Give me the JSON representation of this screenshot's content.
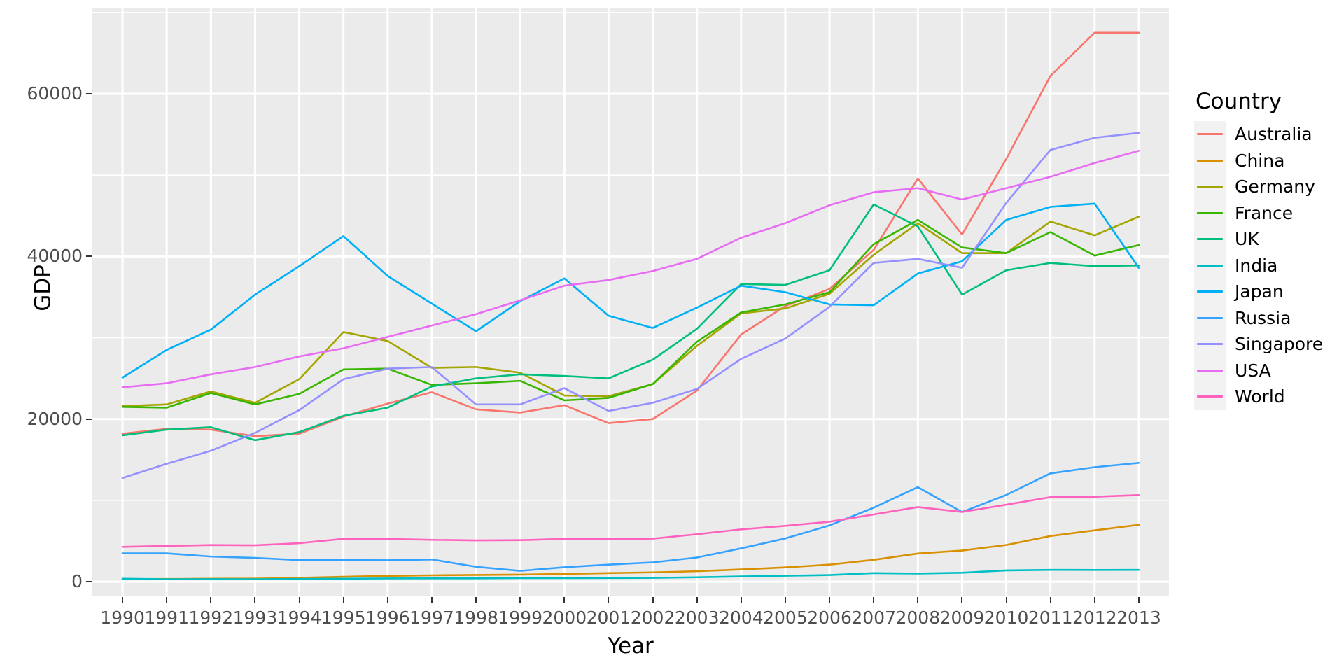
{
  "chart_data": {
    "type": "line",
    "title": "",
    "xlabel": "Year",
    "ylabel": "GDP",
    "legend_title": "Country",
    "legend_position": "right",
    "grid": true,
    "x": [
      1990,
      1991,
      1992,
      1993,
      1994,
      1995,
      1996,
      1997,
      1998,
      1999,
      2000,
      2001,
      2002,
      2003,
      2004,
      2005,
      2006,
      2007,
      2008,
      2009,
      2010,
      2011,
      2012,
      2013
    ],
    "xtick_labels": [
      "1990",
      "1991",
      "1992",
      "1993",
      "1994",
      "1995",
      "1996",
      "1997",
      "1998",
      "1999",
      "2000",
      "2001",
      "2002",
      "2003",
      "2004",
      "2005",
      "2006",
      "2007",
      "2008",
      "2009",
      "2010",
      "2011",
      "2012",
      "2013"
    ],
    "ytick_labels": [
      "0",
      "20000",
      "40000",
      "60000"
    ],
    "ytick_values": [
      0,
      20000,
      40000,
      60000
    ],
    "ylim": [
      -1800,
      70500
    ],
    "series": [
      {
        "name": "Australia",
        "color": "#f8766d",
        "values": [
          18200,
          18800,
          18700,
          17900,
          18200,
          20300,
          21900,
          23300,
          21200,
          20800,
          21700,
          19500,
          20000,
          23500,
          30400,
          33900,
          36000,
          40800,
          49600,
          42700,
          52000,
          62200,
          67500,
          67500
        ]
      },
      {
        "name": "China",
        "color": "#d89000",
        "values": [
          318,
          333,
          366,
          377,
          473,
          609,
          709,
          781,
          828,
          873,
          959,
          1053,
          1149,
          1288,
          1509,
          1753,
          2099,
          2694,
          3468,
          3832,
          4515,
          5618,
          6317,
          6992
        ]
      },
      {
        "name": "Germany",
        "color": "#a3a500",
        "values": [
          21600,
          21800,
          23400,
          22000,
          24900,
          30700,
          29600,
          26300,
          26400,
          25700,
          22900,
          22800,
          24300,
          29000,
          33000,
          33600,
          35400,
          40200,
          44100,
          40400,
          40400,
          44300,
          42600,
          44900
        ]
      },
      {
        "name": "France",
        "color": "#39b600",
        "values": [
          21500,
          21400,
          23200,
          21800,
          23100,
          26100,
          26200,
          24200,
          24400,
          24700,
          22300,
          22600,
          24300,
          29500,
          33100,
          34100,
          35600,
          41500,
          44500,
          41100,
          40400,
          43000,
          40100,
          41400
        ]
      },
      {
        "name": "UK",
        "color": "#00bf7d",
        "values": [
          18000,
          18700,
          19000,
          17400,
          18400,
          20400,
          21400,
          24000,
          25000,
          25500,
          25300,
          25000,
          27300,
          31100,
          36600,
          36500,
          38300,
          46400,
          43700,
          35300,
          38300,
          39200,
          38800,
          38900
        ]
      },
      {
        "name": "India",
        "color": "#00bfc4",
        "values": [
          368,
          304,
          317,
          300,
          340,
          374,
          399,
          415,
          412,
          441,
          443,
          452,
          470,
          546,
          644,
          729,
          820,
          1056,
          1002,
          1101,
          1387,
          1458,
          1444,
          1452
        ]
      },
      {
        "name": "Japan",
        "color": "#00b0f6",
        "values": [
          25100,
          28500,
          31000,
          35300,
          38800,
          42500,
          37600,
          34200,
          30800,
          34500,
          37300,
          32700,
          31200,
          33700,
          36400,
          35600,
          34100,
          34000,
          37900,
          39400,
          44500,
          46100,
          46500,
          38600
        ]
      },
      {
        "name": "Russia",
        "color": "#35a2ff",
        "values": [
          3485,
          3490,
          3095,
          2930,
          2660,
          2670,
          2640,
          2738,
          1835,
          1331,
          1775,
          2100,
          2375,
          2975,
          4100,
          5320,
          6920,
          9100,
          11630,
          8560,
          10670,
          13320,
          14080,
          14610
        ]
      },
      {
        "name": "Singapore",
        "color": "#9590ff",
        "values": [
          12760,
          14500,
          16100,
          18300,
          21100,
          24900,
          26200,
          26400,
          21800,
          21800,
          23800,
          21000,
          22000,
          23700,
          27400,
          29900,
          33800,
          39200,
          39700,
          38600,
          46600,
          53100,
          54600,
          55200
        ]
      },
      {
        "name": "USA",
        "color": "#e76bf3"
      },
      {
        "name": "World",
        "color": "#ff62bc"
      }
    ],
    "series_extra": [
      {
        "name": "USA",
        "color": "#e76bf3",
        "values": [
          23900,
          24400,
          25500,
          26400,
          27700,
          28700,
          30100,
          31500,
          32900,
          34600,
          36400,
          37100,
          38200,
          39700,
          42300,
          44100,
          46300,
          47900,
          48400,
          47000,
          48400,
          49800,
          51500,
          53000
        ]
      },
      {
        "name": "World",
        "color": "#ff62bc",
        "values": [
          4280,
          4400,
          4510,
          4480,
          4740,
          5280,
          5260,
          5150,
          5080,
          5110,
          5260,
          5230,
          5290,
          5840,
          6440,
          6870,
          7370,
          8270,
          9180,
          8570,
          9470,
          10400,
          10450,
          10650
        ]
      }
    ]
  },
  "axis": {
    "ylabel": "GDP",
    "xlabel": "Year"
  },
  "legend": {
    "title": "Country",
    "items": [
      {
        "label": "Australia",
        "color": "#f8766d"
      },
      {
        "label": "China",
        "color": "#d89000"
      },
      {
        "label": "Germany",
        "color": "#a3a500"
      },
      {
        "label": "France",
        "color": "#39b600"
      },
      {
        "label": "UK",
        "color": "#00bf7d"
      },
      {
        "label": "India",
        "color": "#00bfc4"
      },
      {
        "label": "Japan",
        "color": "#00b0f6"
      },
      {
        "label": "Russia",
        "color": "#35a2ff"
      },
      {
        "label": "Singapore",
        "color": "#9590ff"
      },
      {
        "label": "USA",
        "color": "#e76bf3"
      },
      {
        "label": "World",
        "color": "#ff62bc"
      }
    ]
  }
}
